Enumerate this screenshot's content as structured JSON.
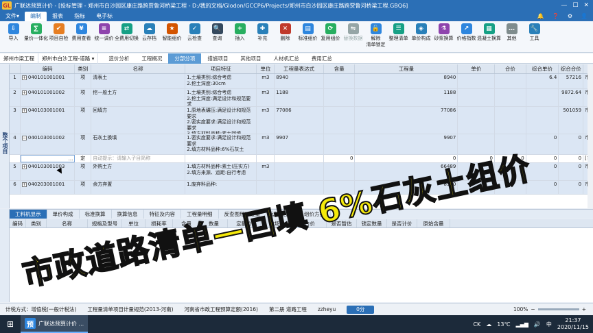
{
  "window": {
    "title": "广联达预算计价 - [投标管理 - 郑州市白沙园区康庄路跨贾鲁河桥梁工程 - D:/我的文档/Glodon/GCCP6/Projects/郑州市白沙园区康庄路跨贾鲁河桥梁工程.GBQ6]",
    "logo": "GL"
  },
  "menu": {
    "items": [
      "文件▾",
      "编制",
      "报表",
      "指标",
      "电子标"
    ],
    "active": "编制",
    "right": [
      "🔔",
      "❓",
      "⚙",
      "👤"
    ]
  },
  "ribbon": [
    {
      "label": "导入",
      "icon": "import-icon",
      "color": "#2e86de",
      "glyph": "⇩"
    },
    {
      "label": "量价一体化",
      "icon": "integrate-icon",
      "color": "#27ae60",
      "glyph": "∑"
    },
    {
      "label": "项目自检",
      "icon": "check-icon",
      "color": "#e67e22",
      "glyph": "✔"
    },
    {
      "label": "费用查看",
      "icon": "view-fee-icon",
      "color": "#2e86de",
      "glyph": "¥"
    },
    {
      "label": "统一调价",
      "icon": "adjust-price-icon",
      "color": "#8e44ad",
      "glyph": "≡"
    },
    {
      "label": "全费用切换",
      "icon": "switch-icon",
      "color": "#16a085",
      "glyph": "⇄"
    },
    {
      "label": "云存档",
      "icon": "cloud-save-icon",
      "color": "#2980b9",
      "glyph": "☁"
    },
    {
      "label": "智能组价",
      "icon": "smart-price-icon",
      "color": "#d35400",
      "glyph": "★"
    },
    {
      "label": "云检查",
      "icon": "cloud-check-icon",
      "color": "#2980b9",
      "glyph": "✓"
    },
    {
      "label": "查询",
      "icon": "query-icon",
      "color": "#34495e",
      "glyph": "🔍"
    },
    {
      "label": "插入",
      "icon": "insert-icon",
      "color": "#27ae60",
      "glyph": "+"
    },
    {
      "label": "补充",
      "icon": "supplement-icon",
      "color": "#2980b9",
      "glyph": "✚"
    },
    {
      "label": "删除",
      "icon": "delete-icon",
      "color": "#c0392b",
      "glyph": "✕"
    },
    {
      "label": "标准组价",
      "icon": "std-price-icon",
      "color": "#2e86de",
      "glyph": "▤"
    },
    {
      "label": "复用组价",
      "icon": "reuse-icon",
      "color": "#27ae60",
      "glyph": "⟳"
    },
    {
      "label": "替换数据",
      "icon": "replace-icon",
      "color": "#95a5a6",
      "glyph": "⇋",
      "disabled": true
    },
    {
      "label": "解除\n清单锁定",
      "icon": "unlock-icon",
      "color": "#2e86de",
      "glyph": "🔓"
    },
    {
      "label": "整理清单",
      "icon": "organize-icon",
      "color": "#16a085",
      "glyph": "☰"
    },
    {
      "label": "单价构成",
      "icon": "unit-price-icon",
      "color": "#2980b9",
      "glyph": "◈"
    },
    {
      "label": "砂浆换算",
      "icon": "mortar-icon",
      "color": "#8e44ad",
      "glyph": "⚗"
    },
    {
      "label": "价格指数",
      "icon": "price-index-icon",
      "color": "#2e86de",
      "glyph": "↗"
    },
    {
      "label": "混凝土换算",
      "icon": "concrete-icon",
      "color": "#16a085",
      "glyph": "▦"
    },
    {
      "label": "其他",
      "icon": "more-icon",
      "color": "#7f8c8d",
      "glyph": "…"
    },
    {
      "label": "工具",
      "icon": "tools-icon",
      "color": "#2980b9",
      "glyph": "🔧"
    }
  ],
  "breadcrumb": [
    "郑州市梁工程",
    "郑州市白沙工程-道路 ▾"
  ],
  "tabs": {
    "items": [
      "造价分析",
      "工程概况",
      "分部分项",
      "措施项目",
      "其他项目",
      "人材机汇总",
      "费用汇总"
    ],
    "active": "分部分项"
  },
  "side_label": "整个项目",
  "grid": {
    "headers": [
      "",
      "编码",
      "类别",
      "名称",
      "项目特征",
      "单位",
      "工程量表达式",
      "含量",
      "工程量",
      "单价",
      "合价",
      "综合单价",
      "综合合价",
      ""
    ],
    "rows": [
      {
        "no": "1",
        "code": "040101001001",
        "type": "项",
        "name": "清表土",
        "feature": "1.土壤类别:综合考虑\n2.挖土深度:30cm",
        "unit": "m3",
        "expr": "8940",
        "qty": "",
        "amount": "8940",
        "price": "",
        "total": "",
        "cunit": "6.4",
        "ctotal": "57216",
        "extra": "市"
      },
      {
        "no": "2",
        "code": "040101001002",
        "type": "项",
        "name": "挖一般土方",
        "feature": "1.土壤类别:综合考虑\n2.挖土深度:满足设计和规范要求",
        "unit": "m3",
        "expr": "1188",
        "qty": "",
        "amount": "1188",
        "price": "",
        "total": "",
        "cunit": "",
        "ctotal": "9872.64",
        "extra": "市"
      },
      {
        "no": "3",
        "code": "040103001001",
        "type": "项",
        "name": "回填方",
        "feature": "1.原地表碾压:满足设计和规范要求\n2.密实度要求:满足设计和规范要求\n3.填方材料品种:素土回填",
        "unit": "m3",
        "expr": "77086",
        "qty": "",
        "amount": "77086",
        "price": "",
        "total": "",
        "cunit": "",
        "ctotal": "501059",
        "extra": "市"
      },
      {
        "no": "4",
        "code": "040103001002",
        "type": "项",
        "name": "石灰土换填",
        "feature": "1.密实度要求:满足设计和规范要求\n2.填方材料品种:6%石灰土",
        "unit": "m3",
        "expr": "9907",
        "qty": "",
        "amount": "9907",
        "price": "",
        "total": "",
        "cunit": "0",
        "ctotal": "0",
        "extra": "市"
      },
      {
        "no": "",
        "code": "",
        "type": "定",
        "name": "自动提示：请输入子目简称",
        "feature": "",
        "unit": "",
        "expr": "",
        "qty": "0",
        "amount": "0",
        "price": "0",
        "total": "0",
        "cunit": "0",
        "ctotal": "0",
        "extra": "[市"
      },
      {
        "no": "5",
        "code": "040103001003",
        "type": "项",
        "name": "外购土方",
        "feature": "1.填方材料品种:素土(压实方)\n2.填方来源、运距:自行考虑",
        "unit": "m3",
        "expr": "",
        "qty": "",
        "amount": "66489",
        "price": "",
        "total": "",
        "cunit": "0",
        "ctotal": "0",
        "extra": "市"
      },
      {
        "no": "6",
        "code": "040203001001",
        "type": "项",
        "name": "余方弃置",
        "feature": "1.废弃料品种:",
        "unit": "",
        "expr": "",
        "qty": "",
        "amount": "8940",
        "price": "",
        "total": "",
        "cunit": "0",
        "ctotal": "0",
        "extra": "市"
      }
    ]
  },
  "lower_tabs": {
    "items": [
      "工料机显示",
      "单价构成",
      "标准换算",
      "换算信息",
      "特征及内容",
      "工程量明细",
      "反查图形工程量",
      "说明信息",
      "组价方案"
    ],
    "active": "工料机显示"
  },
  "lower_headers": [
    "编码",
    "类别",
    "名称",
    "规格及型号",
    "单位",
    "损耗率",
    "含量",
    "数量",
    "定额价",
    "市场价",
    "合价",
    "是否暂估",
    "锁定数量",
    "是否计价",
    "原始含量"
  ],
  "status": {
    "tax": "计税方式：增值税(一般计税法)",
    "spec": "工程量清单项目计量规范(2013-河南)",
    "quota": "河南省市政工程预算定额(2016)",
    "volume": "第二册 道路工程",
    "user": "zzheyu",
    "progress": "0分",
    "zoom": "100%"
  },
  "taskbar": {
    "app": "广联达预算计价 ...",
    "app_icon": "预",
    "weather": "13℃",
    "ime": "中",
    "ck": "CK",
    "time": "21:37",
    "date": "2020/11/15"
  },
  "overlay": {
    "line1": "市政道路清单—回填 6%石灰土组价"
  }
}
